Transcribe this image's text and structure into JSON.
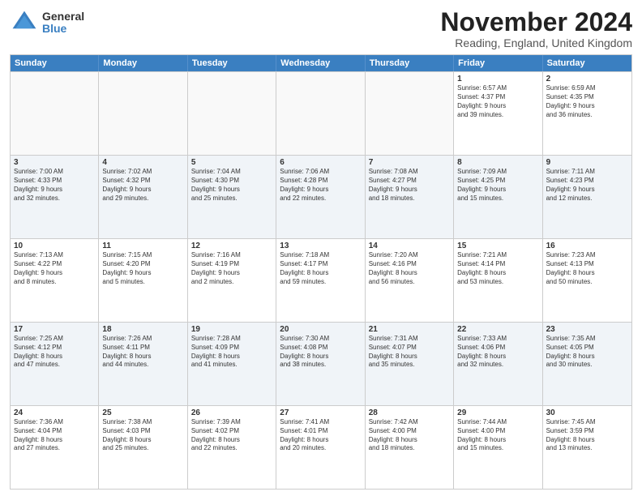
{
  "logo": {
    "general": "General",
    "blue": "Blue"
  },
  "header": {
    "month": "November 2024",
    "location": "Reading, England, United Kingdom"
  },
  "weekdays": [
    "Sunday",
    "Monday",
    "Tuesday",
    "Wednesday",
    "Thursday",
    "Friday",
    "Saturday"
  ],
  "rows": [
    [
      {
        "day": "",
        "info": "",
        "empty": true
      },
      {
        "day": "",
        "info": "",
        "empty": true
      },
      {
        "day": "",
        "info": "",
        "empty": true
      },
      {
        "day": "",
        "info": "",
        "empty": true
      },
      {
        "day": "",
        "info": "",
        "empty": true
      },
      {
        "day": "1",
        "info": "Sunrise: 6:57 AM\nSunset: 4:37 PM\nDaylight: 9 hours\nand 39 minutes.",
        "empty": false
      },
      {
        "day": "2",
        "info": "Sunrise: 6:59 AM\nSunset: 4:35 PM\nDaylight: 9 hours\nand 36 minutes.",
        "empty": false
      }
    ],
    [
      {
        "day": "3",
        "info": "Sunrise: 7:00 AM\nSunset: 4:33 PM\nDaylight: 9 hours\nand 32 minutes.",
        "empty": false
      },
      {
        "day": "4",
        "info": "Sunrise: 7:02 AM\nSunset: 4:32 PM\nDaylight: 9 hours\nand 29 minutes.",
        "empty": false
      },
      {
        "day": "5",
        "info": "Sunrise: 7:04 AM\nSunset: 4:30 PM\nDaylight: 9 hours\nand 25 minutes.",
        "empty": false
      },
      {
        "day": "6",
        "info": "Sunrise: 7:06 AM\nSunset: 4:28 PM\nDaylight: 9 hours\nand 22 minutes.",
        "empty": false
      },
      {
        "day": "7",
        "info": "Sunrise: 7:08 AM\nSunset: 4:27 PM\nDaylight: 9 hours\nand 18 minutes.",
        "empty": false
      },
      {
        "day": "8",
        "info": "Sunrise: 7:09 AM\nSunset: 4:25 PM\nDaylight: 9 hours\nand 15 minutes.",
        "empty": false
      },
      {
        "day": "9",
        "info": "Sunrise: 7:11 AM\nSunset: 4:23 PM\nDaylight: 9 hours\nand 12 minutes.",
        "empty": false
      }
    ],
    [
      {
        "day": "10",
        "info": "Sunrise: 7:13 AM\nSunset: 4:22 PM\nDaylight: 9 hours\nand 8 minutes.",
        "empty": false
      },
      {
        "day": "11",
        "info": "Sunrise: 7:15 AM\nSunset: 4:20 PM\nDaylight: 9 hours\nand 5 minutes.",
        "empty": false
      },
      {
        "day": "12",
        "info": "Sunrise: 7:16 AM\nSunset: 4:19 PM\nDaylight: 9 hours\nand 2 minutes.",
        "empty": false
      },
      {
        "day": "13",
        "info": "Sunrise: 7:18 AM\nSunset: 4:17 PM\nDaylight: 8 hours\nand 59 minutes.",
        "empty": false
      },
      {
        "day": "14",
        "info": "Sunrise: 7:20 AM\nSunset: 4:16 PM\nDaylight: 8 hours\nand 56 minutes.",
        "empty": false
      },
      {
        "day": "15",
        "info": "Sunrise: 7:21 AM\nSunset: 4:14 PM\nDaylight: 8 hours\nand 53 minutes.",
        "empty": false
      },
      {
        "day": "16",
        "info": "Sunrise: 7:23 AM\nSunset: 4:13 PM\nDaylight: 8 hours\nand 50 minutes.",
        "empty": false
      }
    ],
    [
      {
        "day": "17",
        "info": "Sunrise: 7:25 AM\nSunset: 4:12 PM\nDaylight: 8 hours\nand 47 minutes.",
        "empty": false
      },
      {
        "day": "18",
        "info": "Sunrise: 7:26 AM\nSunset: 4:11 PM\nDaylight: 8 hours\nand 44 minutes.",
        "empty": false
      },
      {
        "day": "19",
        "info": "Sunrise: 7:28 AM\nSunset: 4:09 PM\nDaylight: 8 hours\nand 41 minutes.",
        "empty": false
      },
      {
        "day": "20",
        "info": "Sunrise: 7:30 AM\nSunset: 4:08 PM\nDaylight: 8 hours\nand 38 minutes.",
        "empty": false
      },
      {
        "day": "21",
        "info": "Sunrise: 7:31 AM\nSunset: 4:07 PM\nDaylight: 8 hours\nand 35 minutes.",
        "empty": false
      },
      {
        "day": "22",
        "info": "Sunrise: 7:33 AM\nSunset: 4:06 PM\nDaylight: 8 hours\nand 32 minutes.",
        "empty": false
      },
      {
        "day": "23",
        "info": "Sunrise: 7:35 AM\nSunset: 4:05 PM\nDaylight: 8 hours\nand 30 minutes.",
        "empty": false
      }
    ],
    [
      {
        "day": "24",
        "info": "Sunrise: 7:36 AM\nSunset: 4:04 PM\nDaylight: 8 hours\nand 27 minutes.",
        "empty": false
      },
      {
        "day": "25",
        "info": "Sunrise: 7:38 AM\nSunset: 4:03 PM\nDaylight: 8 hours\nand 25 minutes.",
        "empty": false
      },
      {
        "day": "26",
        "info": "Sunrise: 7:39 AM\nSunset: 4:02 PM\nDaylight: 8 hours\nand 22 minutes.",
        "empty": false
      },
      {
        "day": "27",
        "info": "Sunrise: 7:41 AM\nSunset: 4:01 PM\nDaylight: 8 hours\nand 20 minutes.",
        "empty": false
      },
      {
        "day": "28",
        "info": "Sunrise: 7:42 AM\nSunset: 4:00 PM\nDaylight: 8 hours\nand 18 minutes.",
        "empty": false
      },
      {
        "day": "29",
        "info": "Sunrise: 7:44 AM\nSunset: 4:00 PM\nDaylight: 8 hours\nand 15 minutes.",
        "empty": false
      },
      {
        "day": "30",
        "info": "Sunrise: 7:45 AM\nSunset: 3:59 PM\nDaylight: 8 hours\nand 13 minutes.",
        "empty": false
      }
    ]
  ]
}
